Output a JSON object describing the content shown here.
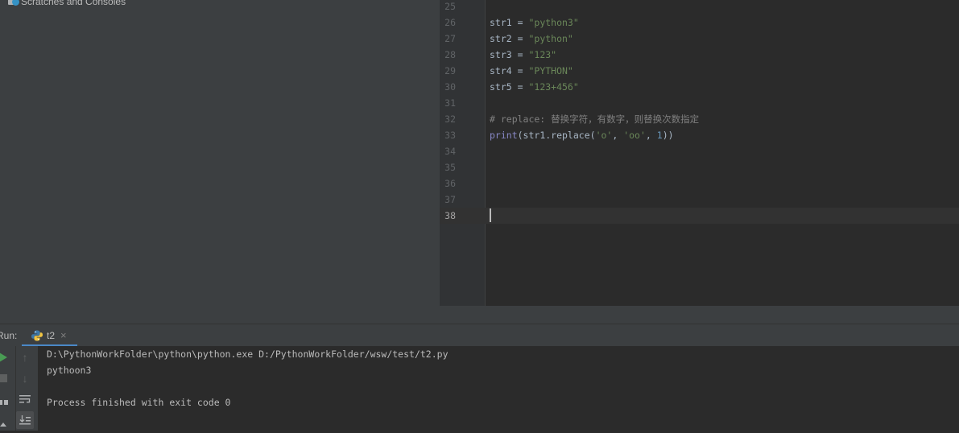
{
  "project_panel": {
    "item_label": "Scratches and Consoles"
  },
  "editor": {
    "lines": [
      {
        "num": "25",
        "tokens": []
      },
      {
        "num": "26",
        "tokens": [
          {
            "t": "plain",
            "v": "str1 = "
          },
          {
            "t": "str",
            "v": "\"python3\""
          }
        ]
      },
      {
        "num": "27",
        "tokens": [
          {
            "t": "plain",
            "v": "str2 = "
          },
          {
            "t": "str",
            "v": "\"python\""
          }
        ]
      },
      {
        "num": "28",
        "tokens": [
          {
            "t": "plain",
            "v": "str3 = "
          },
          {
            "t": "str",
            "v": "\"123\""
          }
        ]
      },
      {
        "num": "29",
        "tokens": [
          {
            "t": "plain",
            "v": "str4 = "
          },
          {
            "t": "str",
            "v": "\"PYTHON\""
          }
        ]
      },
      {
        "num": "30",
        "tokens": [
          {
            "t": "plain",
            "v": "str5 = "
          },
          {
            "t": "str",
            "v": "\"123+456\""
          }
        ]
      },
      {
        "num": "31",
        "tokens": []
      },
      {
        "num": "32",
        "tokens": [
          {
            "t": "cmt",
            "v": "# replace: 替换字符，有数字，则替换次数指定"
          }
        ]
      },
      {
        "num": "33",
        "tokens": [
          {
            "t": "fn",
            "v": "print"
          },
          {
            "t": "plain",
            "v": "(str1.replace("
          },
          {
            "t": "str",
            "v": "'o'"
          },
          {
            "t": "plain",
            "v": ", "
          },
          {
            "t": "str",
            "v": "'oo'"
          },
          {
            "t": "plain",
            "v": ", "
          },
          {
            "t": "num",
            "v": "1"
          },
          {
            "t": "plain",
            "v": "))"
          }
        ]
      },
      {
        "num": "34",
        "tokens": []
      },
      {
        "num": "35",
        "tokens": []
      },
      {
        "num": "36",
        "tokens": []
      },
      {
        "num": "37",
        "tokens": []
      },
      {
        "num": "38",
        "tokens": []
      }
    ],
    "current_line_index": 13
  },
  "run_panel": {
    "label": "Run:",
    "tab_name": "t2",
    "tab_close": "×",
    "console_lines": [
      "D:\\PythonWorkFolder\\python\\python.exe D:/PythonWorkFolder/wsw/test/t2.py",
      "pythoon3",
      "",
      "Process finished with exit code 0"
    ]
  },
  "icons": {
    "run": "run-icon",
    "stop": "stop-icon",
    "up": "up-arrow-icon",
    "down": "down-arrow-icon",
    "wrap": "soft-wrap-icon",
    "scroll": "scroll-to-end-icon"
  }
}
